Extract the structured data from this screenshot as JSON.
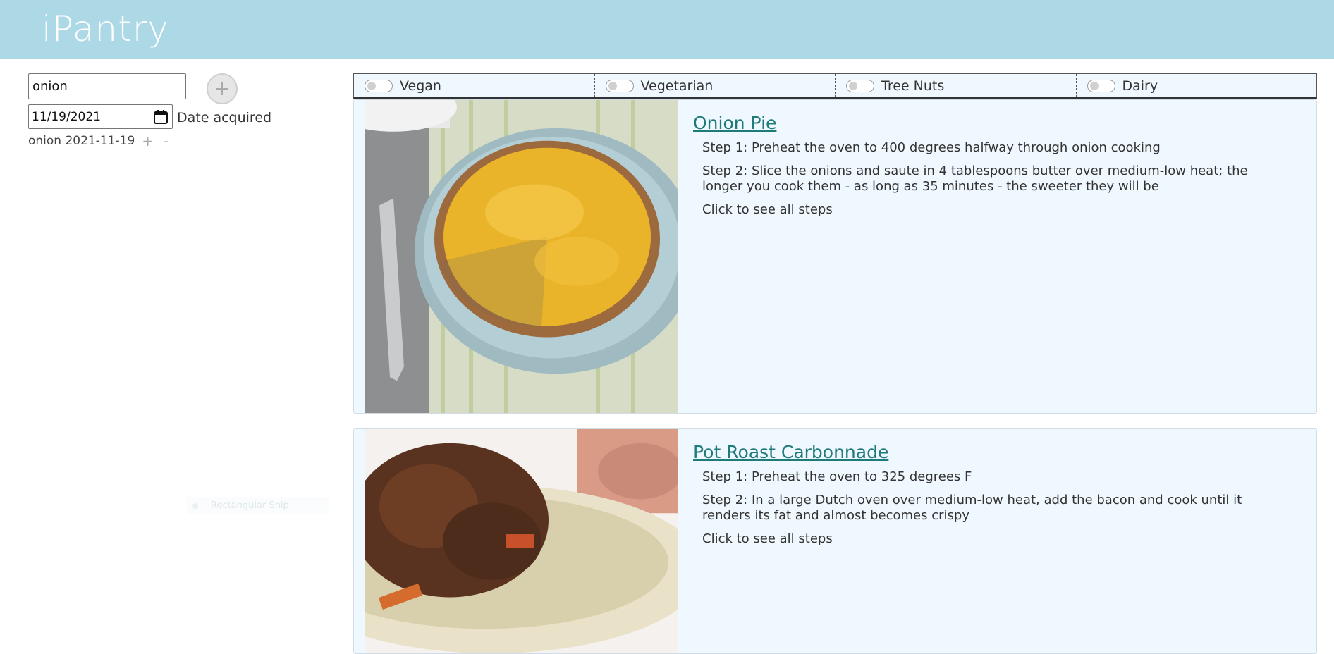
{
  "app": {
    "title": "iPantry"
  },
  "pantry": {
    "ingredient_value": "onion",
    "date_value": "11/19/2021",
    "date_label": "Date acquired",
    "items": [
      {
        "label": "onion 2021-11-19",
        "plus": "+",
        "minus": "-"
      }
    ]
  },
  "tooltip": {
    "text": "Rectangular Snip"
  },
  "filters": [
    {
      "label": "Vegan"
    },
    {
      "label": "Vegetarian"
    },
    {
      "label": "Tree Nuts"
    },
    {
      "label": "Dairy"
    }
  ],
  "recipes": [
    {
      "title": "Onion Pie",
      "steps": [
        "Step 1: Preheat the oven to 400 degrees halfway through onion cooking",
        "Step 2: Slice the onions and saute in 4 tablespoons butter over medium-low heat; the longer you cook them - as long as 35 minutes - the sweeter they will be"
      ],
      "more": "Click to see all steps"
    },
    {
      "title": "Pot Roast Carbonnade",
      "steps": [
        "Step 1: Preheat the oven to 325 degrees F",
        "Step 2: In a large Dutch oven over medium-low heat, add the bacon and cook until it renders its fat and almost becomes crispy"
      ],
      "more": "Click to see all steps"
    }
  ],
  "colors": {
    "header": "#add8e6",
    "panel": "#f0f8ff",
    "link": "#1f7a7a"
  }
}
